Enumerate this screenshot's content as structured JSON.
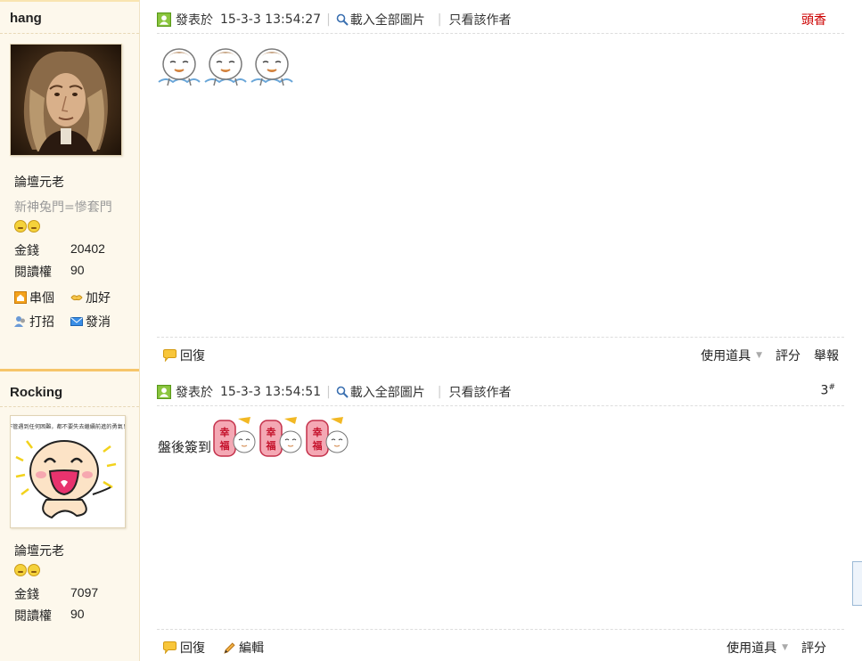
{
  "posts": [
    {
      "author": "hang",
      "title": "論壇元老",
      "subtitle": "新神兔門=慘套門",
      "stats": [
        {
          "label": "金錢",
          "value": "20402"
        },
        {
          "label": "閱讀權",
          "value": "90"
        }
      ],
      "actions": {
        "home": "串個",
        "add_friend": "加好",
        "poke": "打招",
        "message": "發消"
      },
      "meta": {
        "posted_prefix": "發表於",
        "datetime": "15-3-3 13:54:27",
        "load_images": "載入全部圖片",
        "only_author": "只看該作者"
      },
      "floor": "頭香",
      "body_text": "",
      "emoticon_count": 3,
      "footer": {
        "reply": "回復",
        "tools": "使用道具",
        "rate": "評分",
        "report": "舉報"
      }
    },
    {
      "author": "Rocking",
      "title": "論壇元老",
      "stats": [
        {
          "label": "金錢",
          "value": "7097"
        },
        {
          "label": "閱讀權",
          "value": "90"
        }
      ],
      "meta": {
        "posted_prefix": "發表於",
        "datetime": "15-3-3 13:54:51",
        "load_images": "載入全部圖片",
        "only_author": "只看該作者"
      },
      "floor": "3",
      "floor_suffix": "#",
      "body_text": "盤後簽到",
      "emoticon_text": "幸福",
      "avatar_caption": "不管遇到任何困難，都不要失去繼續前進的勇氣！",
      "footer": {
        "reply": "回復",
        "edit": "編輯",
        "tools": "使用道具",
        "rate": "評分"
      }
    }
  ],
  "colors": {
    "accent_border": "#f6c56a",
    "sidebar_bg": "#fdf8ec",
    "floor_red": "#cc0000"
  }
}
